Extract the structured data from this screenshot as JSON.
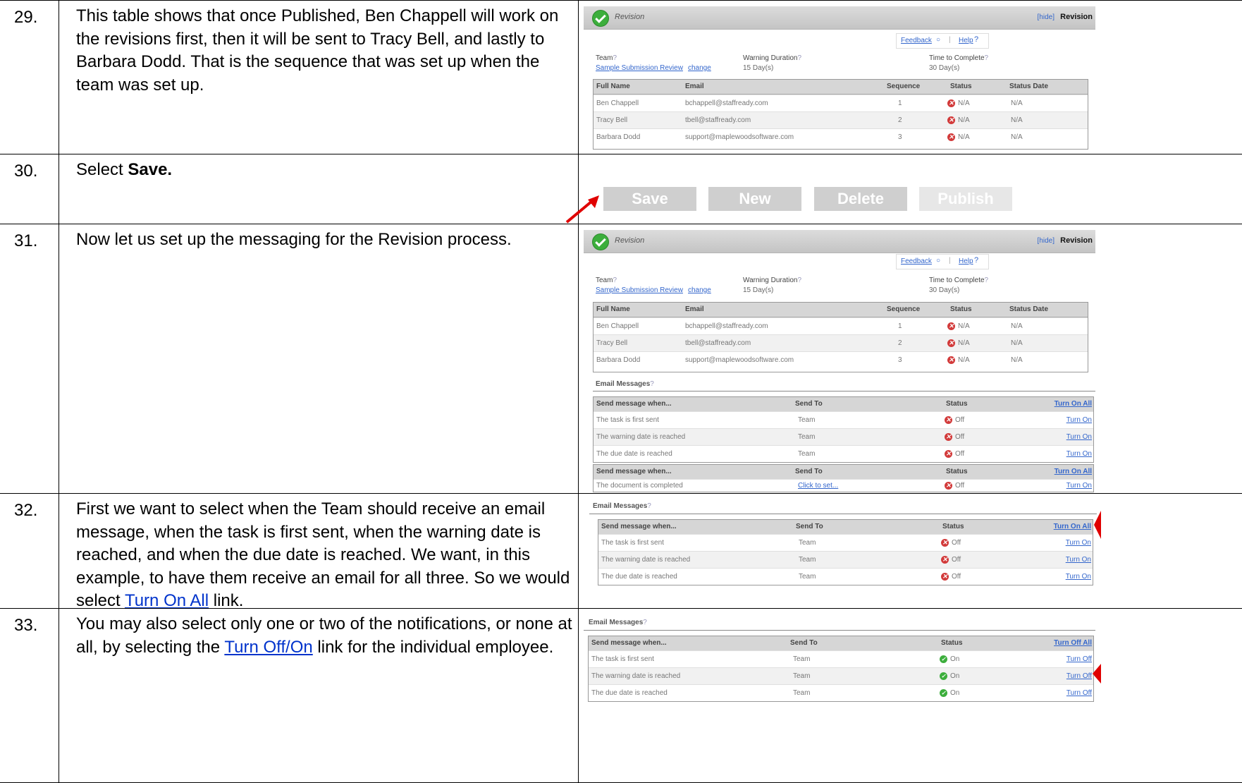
{
  "steps": [
    {
      "num": "29.",
      "text": "This table shows that once Published, Ben Chappell will work on the revisions first, then it will be sent to Tracy Bell, and lastly to Barbara Dodd.  That is the sequence that was set up when the team was set up."
    },
    {
      "num": "30.",
      "text_pre": "Select ",
      "text_bold": "Save."
    },
    {
      "num": "31.",
      "text": "Now let us set up the messaging for the Revision process."
    },
    {
      "num": "32.",
      "text_pre": "First we want to select when the Team should receive an email message, when the task is first sent, when the warning date is reached, and when the due date is reached.  We want, in this example, to have them receive an email for all three.  So we would select ",
      "link": "Turn On All",
      "text_post": " link."
    },
    {
      "num": "33.",
      "text_pre": "You may also select only one or two of the notifications, or none at all, by selecting the ",
      "link": "Turn Off/On",
      "text_post": " link for the individual employee."
    }
  ],
  "revision_panel": {
    "title": "Revision",
    "hide": "[hide]",
    "right_title": "Revision",
    "feedback": "Feedback",
    "help": "Help",
    "team_label": "Team",
    "team_value": "Sample Submission Review",
    "team_change": "change",
    "warning_label": "Warning Duration",
    "warning_value": "15 Day(s)",
    "time_label": "Time to Complete",
    "time_value": "30 Day(s)",
    "columns": [
      "Full Name",
      "Email",
      "Sequence",
      "Status",
      "Status Date"
    ],
    "rows": [
      {
        "name": "Ben Chappell",
        "email": "bchappell@staffready.com",
        "seq": "1",
        "status": "N/A",
        "date": "N/A"
      },
      {
        "name": "Tracy Bell",
        "email": "tbell@staffready.com",
        "seq": "2",
        "status": "N/A",
        "date": "N/A"
      },
      {
        "name": "Barbara Dodd",
        "email": "support@maplewoodsoftware.com",
        "seq": "3",
        "status": "N/A",
        "date": "N/A"
      }
    ]
  },
  "buttons": {
    "save": "Save",
    "new": "New",
    "delete": "Delete",
    "publish": "Publish"
  },
  "email_messages": {
    "title": "Email Messages",
    "columns": [
      "Send message when...",
      "Send To",
      "Status"
    ],
    "turn_on_all": "Turn On All",
    "turn_off_all": "Turn Off All",
    "turn_on": "Turn On",
    "turn_off": "Turn Off",
    "rows": [
      {
        "when": "The task is first sent",
        "to": "Team"
      },
      {
        "when": "The warning date is reached",
        "to": "Team"
      },
      {
        "when": "The due date is reached",
        "to": "Team"
      }
    ],
    "status_off": "Off",
    "status_on": "On",
    "doc_row": {
      "when": "The document is completed",
      "to": "Click to set..."
    }
  }
}
